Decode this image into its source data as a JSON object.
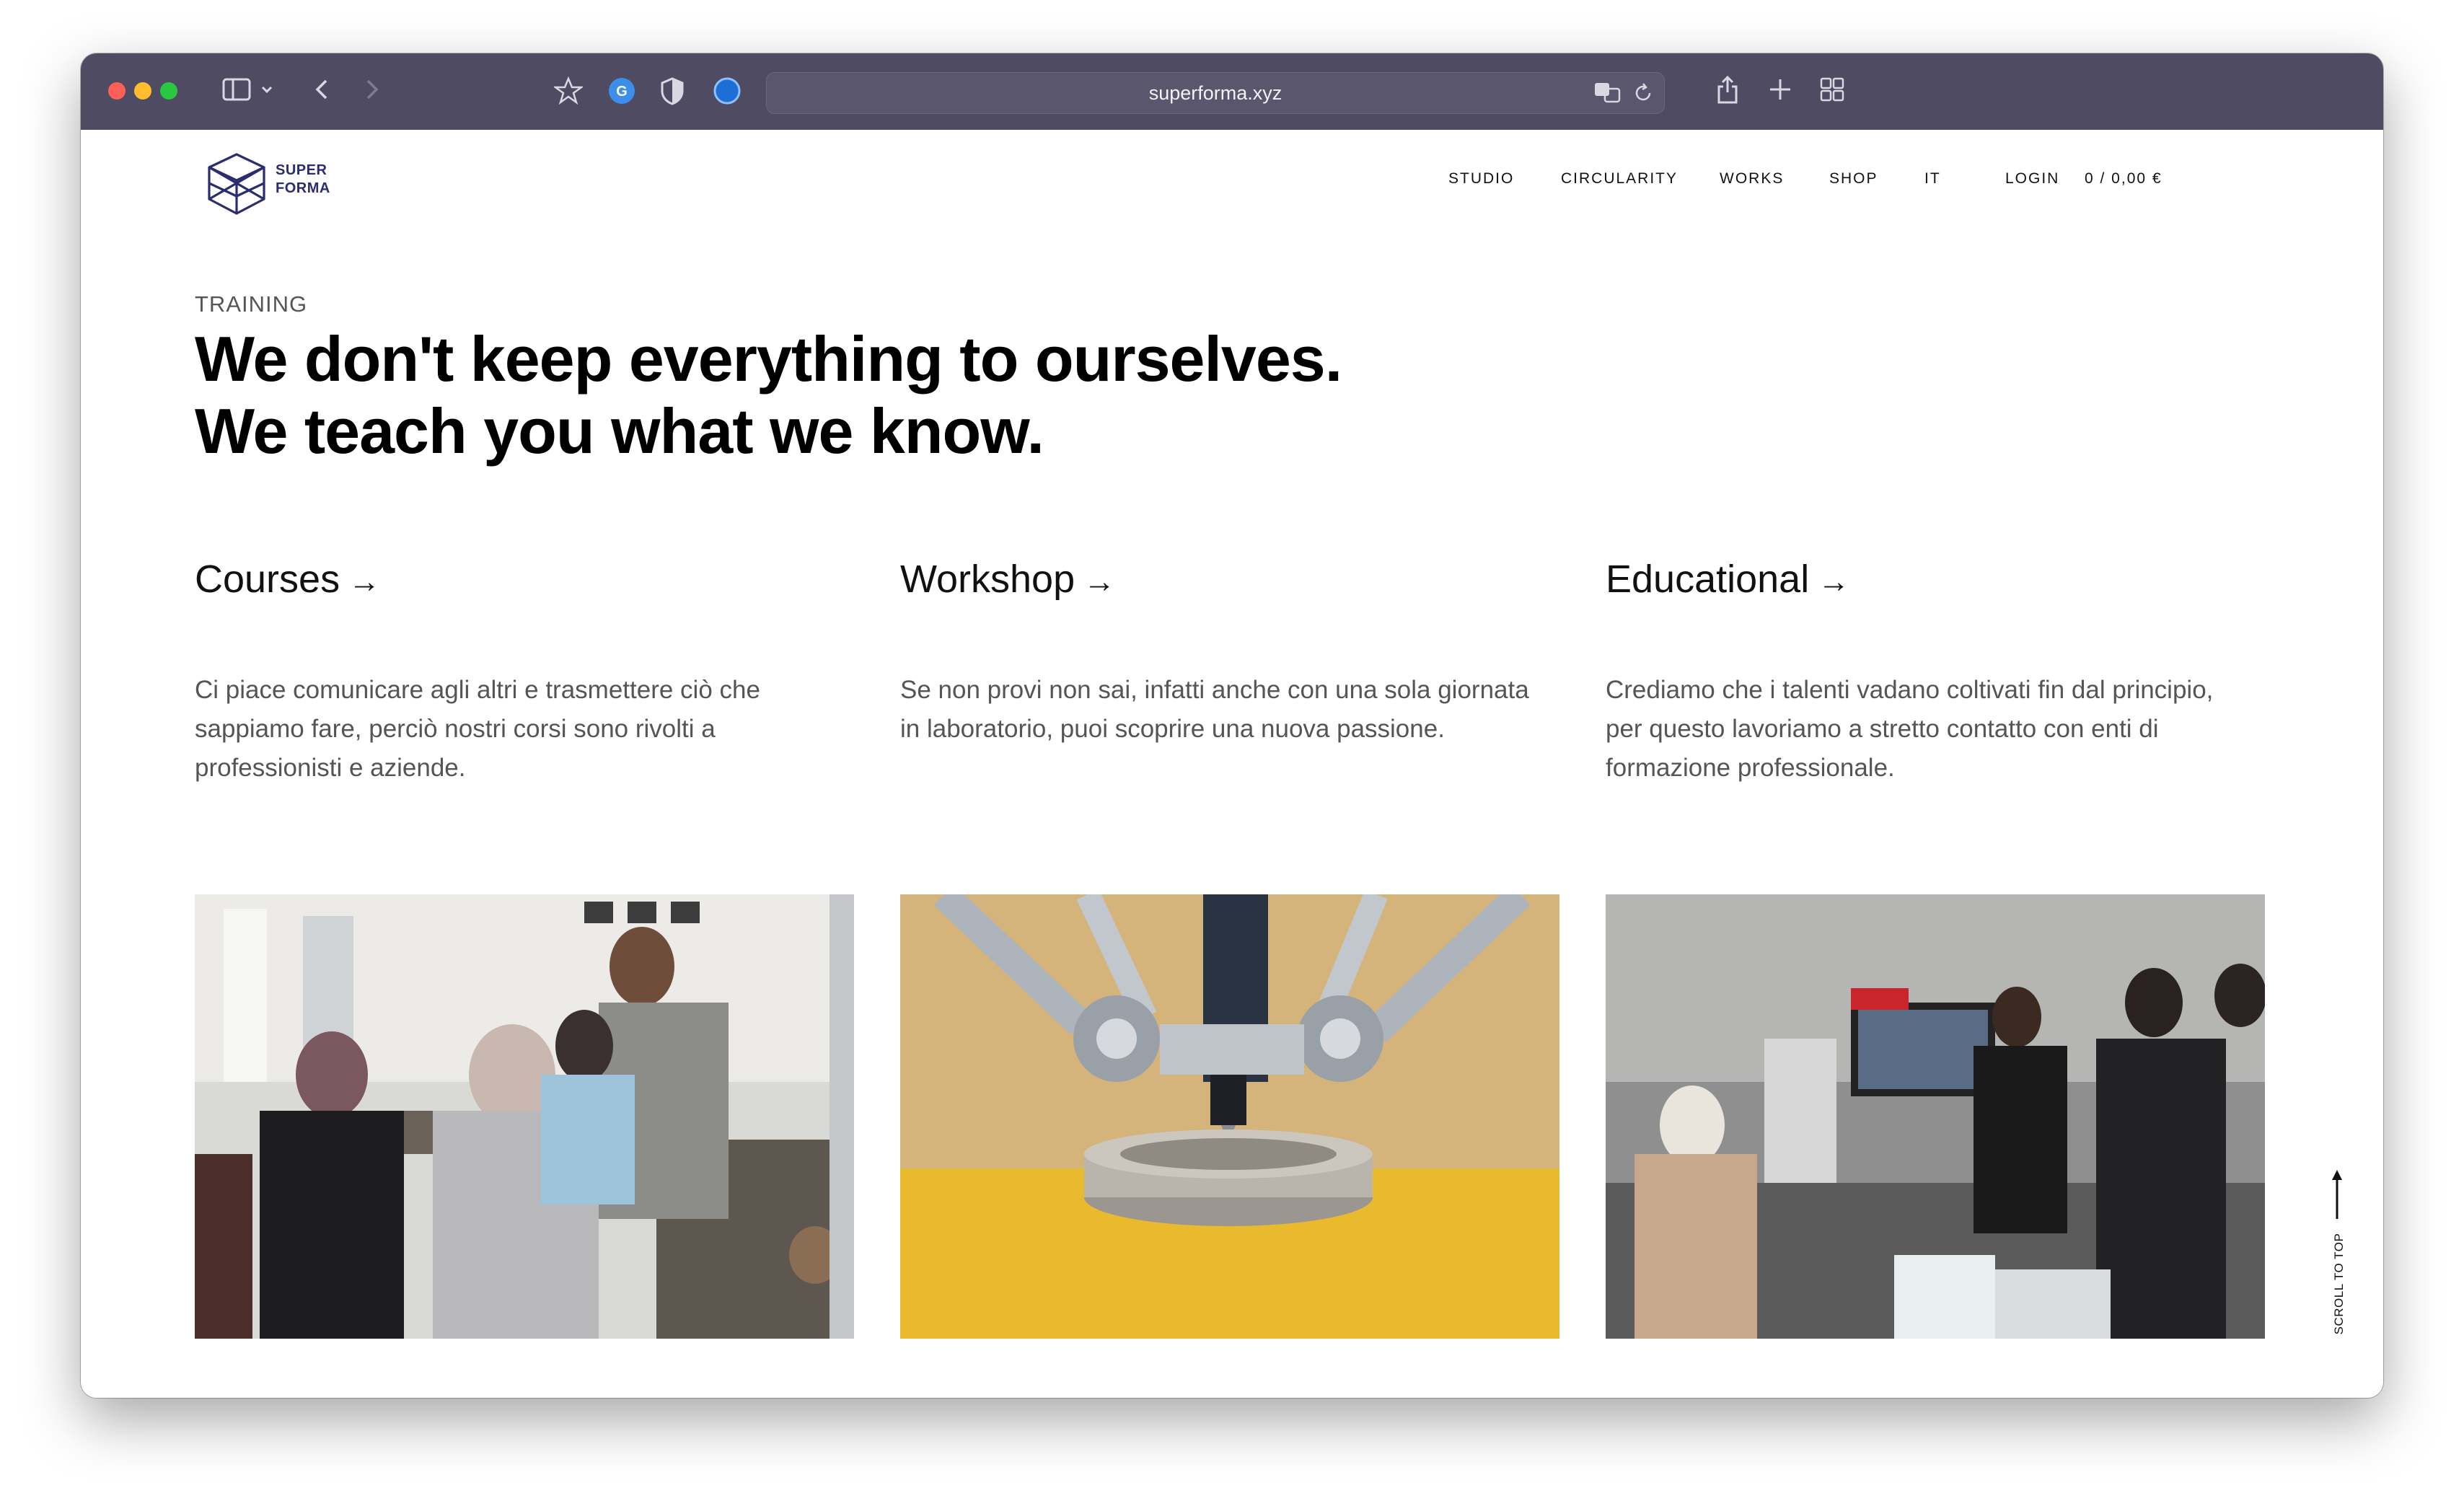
{
  "browser": {
    "url": "superforma.xyz"
  },
  "site": {
    "logo_line1": "SUPER",
    "logo_line2": "FORMA",
    "nav": [
      "STUDIO",
      "CIRCULARITY",
      "WORKS",
      "SHOP",
      "IT",
      "LOGIN",
      "0 / 0,00 €"
    ]
  },
  "hero": {
    "eyebrow": "TRAINING",
    "line1": "We don't keep everything to ourselves.",
    "line2": "We teach you what we know."
  },
  "columns": [
    {
      "title": "Courses",
      "arrow": "→",
      "description": "Ci piace comunicare agli altri e trasmettere ciò che sappiamo fare, perciò nostri corsi sono rivolti a professionisti e aziende."
    },
    {
      "title": "Workshop",
      "arrow": "→",
      "description": "Se non provi non sai, infatti anche con una sola giornata in laboratorio, puoi scoprire una nuova passione."
    },
    {
      "title": "Educational",
      "arrow": "→",
      "description": "Crediamo che i talenti vadano coltivati fin dal principio, per questo lavoriamo a stretto contatto con enti di formazione professionale."
    }
  ],
  "scroll_top": "SCROLL TO TOP",
  "colors": {
    "toolbar": "#4f4b62",
    "logo": "#2b2d6e",
    "workshop_yellow": "#e9b92e"
  }
}
